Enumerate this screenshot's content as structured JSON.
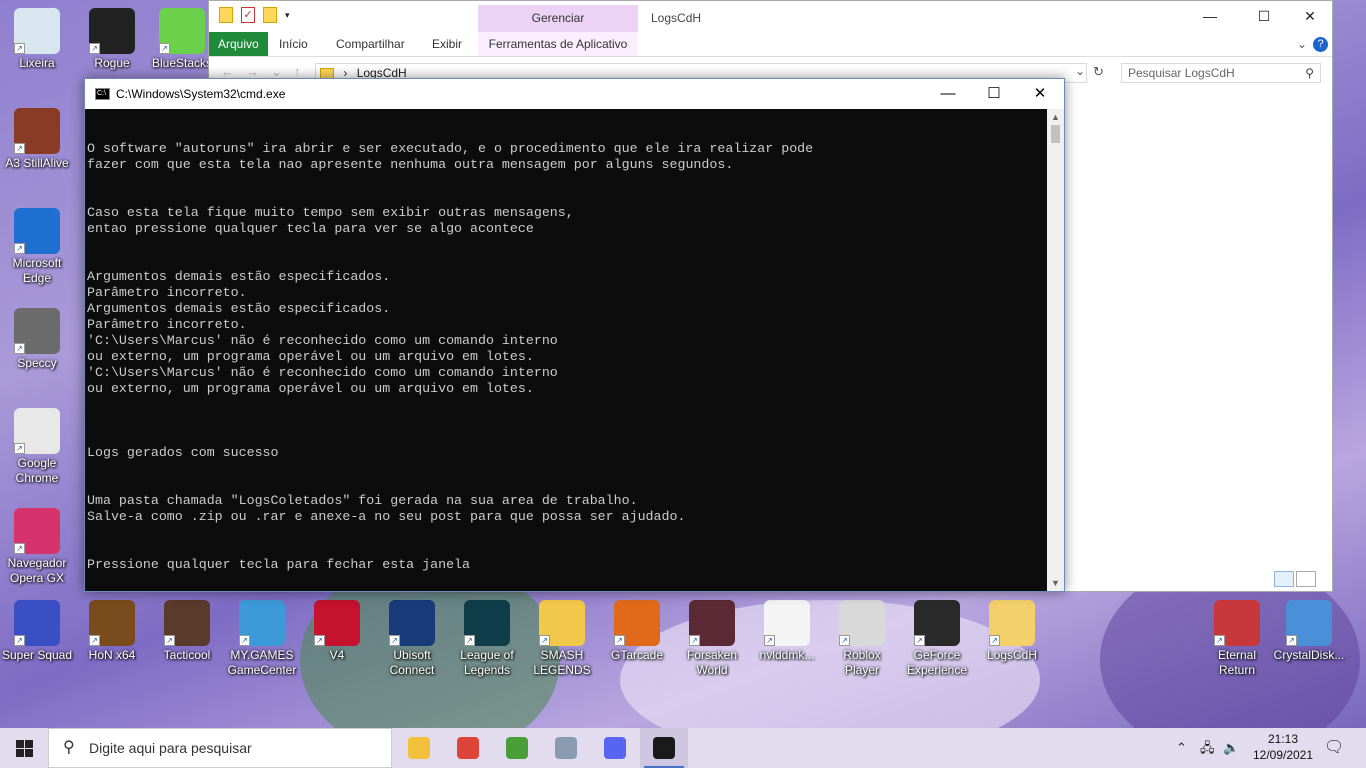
{
  "desktop": {
    "left_icons": [
      {
        "label": "Lixeira",
        "color": "#d8e6f0"
      },
      {
        "label": "A3 StillAlive",
        "color": "#8a3b26"
      },
      {
        "label": "Microsoft Edge",
        "color": "#1e6fd0"
      },
      {
        "label": "Speccy",
        "color": "#6b6b6b"
      },
      {
        "label": "Google Chrome",
        "color": "#e8e8e8"
      },
      {
        "label": "Navegador Opera GX",
        "color": "#d6336c"
      }
    ],
    "top_icons": [
      {
        "label": "Rogue",
        "color": "#222222"
      },
      {
        "label": "BlueStacks",
        "color": "#6bd04a"
      }
    ],
    "bottom_icons": [
      {
        "label": "Super Squad",
        "color": "#3a4fc4"
      },
      {
        "label": "HoN x64",
        "color": "#7a4b1d"
      },
      {
        "label": "Tacticool",
        "color": "#5a3a2a"
      },
      {
        "label": "MY.GAMES GameCenter",
        "color": "#3c9ad8"
      },
      {
        "label": "V4",
        "color": "#c4122f"
      },
      {
        "label": "Ubisoft Connect",
        "color": "#1a3b7a"
      },
      {
        "label": "League of Legends",
        "color": "#0f3d4a"
      },
      {
        "label": "SMASH LEGENDS",
        "color": "#f2c84b"
      },
      {
        "label": "GTarcade",
        "color": "#e06a1a"
      },
      {
        "label": "Forsaken World",
        "color": "#5b2a35"
      },
      {
        "label": "nvlddmk...",
        "color": "#f4f4f4"
      },
      {
        "label": "Roblox Player",
        "color": "#d9d9d9"
      },
      {
        "label": "GeForce Experience",
        "color": "#2a2a2a"
      },
      {
        "label": "LogsCdH",
        "color": "#f3d06a"
      }
    ],
    "right_icons": [
      {
        "label": "Eternal Return",
        "color": "#c8383b"
      },
      {
        "label": "CrystalDisk...",
        "color": "#4a90d9"
      }
    ]
  },
  "explorer": {
    "title": "LogsCdH",
    "context_tab_header": "Gerenciar",
    "tabs": [
      "Arquivo",
      "Início",
      "Compartilhar",
      "Exibir",
      "Ferramentas de Aplicativo"
    ],
    "address": "LogsCdH",
    "search_placeholder": "Pesquisar LogsCdH",
    "accent": "#1e8a3a"
  },
  "cmd": {
    "title": "C:\\Windows\\System32\\cmd.exe",
    "lines": [
      "O software \"autoruns\" ira abrir e ser executado, e o procedimento que ele ira realizar pode",
      "fazer com que esta tela nao apresente nenhuma outra mensagem por alguns segundos.",
      "",
      "",
      "Caso esta tela fique muito tempo sem exibir outras mensagens,",
      "entao pressione qualquer tecla para ver se algo acontece",
      "",
      "",
      "Argumentos demais estão especificados.",
      "Parâmetro incorreto.",
      "Argumentos demais estão especificados.",
      "Parâmetro incorreto.",
      "'C:\\Users\\Marcus' não é reconhecido como um comando interno",
      "ou externo, um programa operável ou um arquivo em lotes.",
      "'C:\\Users\\Marcus' não é reconhecido como um comando interno",
      "ou externo, um programa operável ou um arquivo em lotes.",
      "",
      "",
      "",
      "Logs gerados com sucesso",
      "",
      "",
      "Uma pasta chamada \"LogsColetados\" foi gerada na sua area de trabalho.",
      "Salve-a como .zip ou .rar e anexe-a no seu post para que possa ser ajudado.",
      "",
      "",
      "Pressione qualquer tecla para fechar esta janela"
    ]
  },
  "taskbar": {
    "search_placeholder": "Digite aqui para pesquisar",
    "apps": [
      {
        "name": "file-explorer",
        "color": "#f3c03c"
      },
      {
        "name": "chrome",
        "color": "#db4437"
      },
      {
        "name": "utorrent",
        "color": "#4a9e3a"
      },
      {
        "name": "image-viewer",
        "color": "#8a9bb0"
      },
      {
        "name": "discord-game",
        "color": "#5865f2"
      },
      {
        "name": "cmd",
        "color": "#1a1a1a"
      }
    ],
    "time": "21:13",
    "date": "12/09/2021"
  }
}
